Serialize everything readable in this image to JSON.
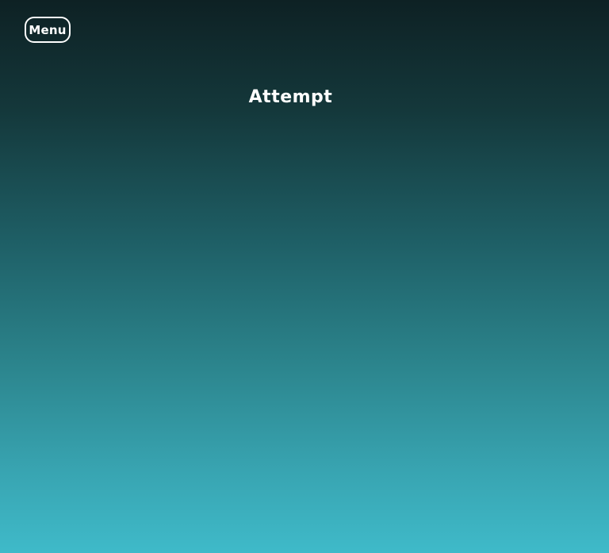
{
  "header": {
    "menu_label": "Menu"
  },
  "main": {
    "title": "Attempt"
  },
  "colors": {
    "background_top": "#0e2124",
    "background_bottom": "#3fbac9",
    "text": "#ffffff"
  }
}
